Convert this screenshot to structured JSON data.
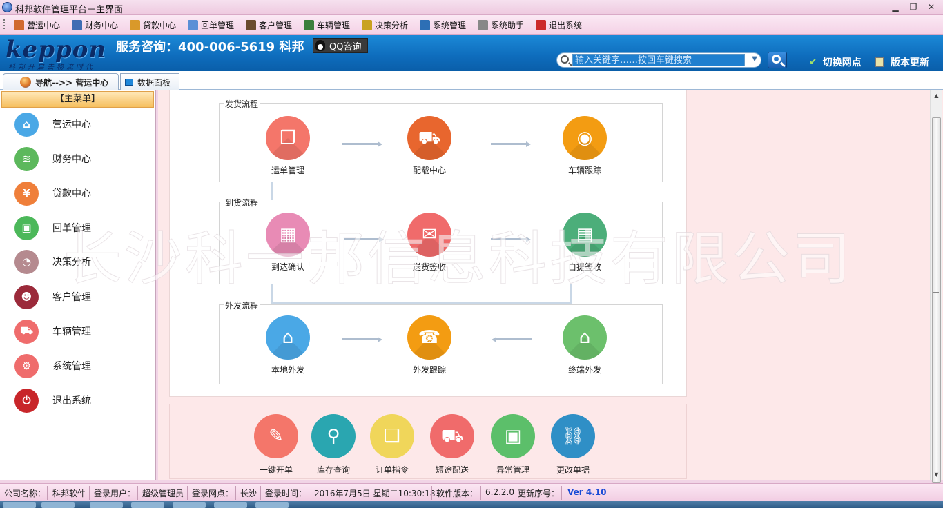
{
  "window": {
    "title": "科邦软件管理平台－主界面",
    "minimize": "▁",
    "restore": "❐",
    "close": "✕"
  },
  "menu": {
    "items": [
      {
        "label": "营运中心",
        "icon": "operations-icon",
        "color": "#d0692f"
      },
      {
        "label": "财务中心",
        "icon": "finance-chart-icon",
        "color": "#3f6db3"
      },
      {
        "label": "贷款中心",
        "icon": "loan-bag-icon",
        "color": "#d9992a"
      },
      {
        "label": "回单管理",
        "icon": "receipt-icon",
        "color": "#5b8fd6"
      },
      {
        "label": "客户管理",
        "icon": "customer-icon",
        "color": "#6a4b2d"
      },
      {
        "label": "车辆管理",
        "icon": "truck-icon",
        "color": "#3c7f3c"
      },
      {
        "label": "决策分析",
        "icon": "analysis-icon",
        "color": "#c9a220"
      },
      {
        "label": "系统管理",
        "icon": "system-icon",
        "color": "#2d6fb5"
      },
      {
        "label": "系统助手",
        "icon": "assistant-icon",
        "color": "#888888"
      },
      {
        "label": "退出系统",
        "icon": "exit-icon",
        "color": "#cc2a2a"
      }
    ]
  },
  "header": {
    "logo": "keppon",
    "slogan": "科邦开启去物流时代",
    "service": "服务咨询：400-006-5619  科邦",
    "qq": "QQ咨询",
    "search_placeholder": "输入关键字……按回车键搜索",
    "switch_site": "切换网点",
    "version_update": "版本更新"
  },
  "tabs": {
    "nav": "导航-->> 营运中心",
    "dashboard": "数据面板"
  },
  "sidebar": {
    "title": "【主菜单】",
    "items": [
      {
        "label": "营运中心",
        "icon": "home-icon",
        "color": "#4aa8e6",
        "glyph": "⌂"
      },
      {
        "label": "财务中心",
        "icon": "coins-icon",
        "color": "#5cb85c",
        "glyph": "≋"
      },
      {
        "label": "贷款中心",
        "icon": "money-bag-icon",
        "color": "#ef7f3a",
        "glyph": "¥"
      },
      {
        "label": "回单管理",
        "icon": "box-icon",
        "color": "#4cb85a",
        "glyph": "▣"
      },
      {
        "label": "决策分析",
        "icon": "pie-chart-icon",
        "color": "#b58a8f",
        "glyph": "◔"
      },
      {
        "label": "客户管理",
        "icon": "customers-icon",
        "color": "#9b2a3a",
        "glyph": "☻"
      },
      {
        "label": "车辆管理",
        "icon": "truck-icon",
        "color": "#ef6c6c",
        "glyph": "⛟"
      },
      {
        "label": "系统管理",
        "icon": "gear-icon",
        "color": "#ef6c6c",
        "glyph": "⚙"
      },
      {
        "label": "退出系统",
        "icon": "power-icon",
        "color": "#c8262a",
        "glyph": "⏻"
      }
    ]
  },
  "flows": {
    "ship": {
      "title": "发货流程",
      "nodes": [
        {
          "label": "运单管理",
          "icon": "waybill-icon",
          "color": "#f4766a",
          "glyph": "❐"
        },
        {
          "label": "配载中心",
          "icon": "delivery-truck-icon",
          "color": "#e8662e",
          "glyph": "⛟"
        },
        {
          "label": "车辆跟踪",
          "icon": "tracking-signal-icon",
          "color": "#f39c12",
          "glyph": "◉"
        }
      ]
    },
    "arrive": {
      "title": "到货流程",
      "nodes": [
        {
          "label": "到达确认",
          "icon": "touch-grid-icon",
          "color": "#e88bb5",
          "glyph": "▦"
        },
        {
          "label": "送货签收",
          "icon": "sign-receipt-icon",
          "color": "#f06b6b",
          "glyph": "✉"
        },
        {
          "label": "自提签收",
          "icon": "pickup-sign-icon",
          "color": "#4cae7a",
          "glyph": "▤"
        }
      ]
    },
    "outsource": {
      "title": "外发流程",
      "nodes": [
        {
          "label": "本地外发",
          "icon": "local-home-icon",
          "color": "#4aa8e6",
          "glyph": "⌂"
        },
        {
          "label": "外发跟踪",
          "icon": "phone-track-icon",
          "color": "#f39c12",
          "glyph": "☎"
        },
        {
          "label": "终端外发",
          "icon": "terminal-home-icon",
          "color": "#6cc06c",
          "glyph": "⌂"
        }
      ]
    }
  },
  "quick": {
    "items": [
      {
        "label": "一键开单",
        "icon": "pencil-icon",
        "color": "#f4766a",
        "glyph": "✎"
      },
      {
        "label": "库存查询",
        "icon": "search-icon",
        "color": "#2aa6b0",
        "glyph": "⚲"
      },
      {
        "label": "订单指令",
        "icon": "documents-icon",
        "color": "#f0d65a",
        "glyph": "❏"
      },
      {
        "label": "短途配送",
        "icon": "delivery-van-icon",
        "color": "#f06b6b",
        "glyph": "⛟"
      },
      {
        "label": "异常管理",
        "icon": "box-alert-icon",
        "color": "#5cbf6a",
        "glyph": "▣"
      },
      {
        "label": "更改单据",
        "icon": "link-edit-icon",
        "color": "#2f8fc6",
        "glyph": "⛓"
      }
    ]
  },
  "watermark": "长沙科一邦信息科技有限公司",
  "status": {
    "company_label": "公司名称：",
    "company": "科邦软件",
    "user_label": "登录用户：",
    "user": "超级管理员",
    "site_label": "登录网点：",
    "site": "长沙",
    "time_label": "登录时间：",
    "time": "2016年7月5日 星期二10:30:18",
    "version_label": "软件版本：",
    "version": "6.2.2.0",
    "serial_label": "更新序号：",
    "serial": "Ver 4.10"
  }
}
